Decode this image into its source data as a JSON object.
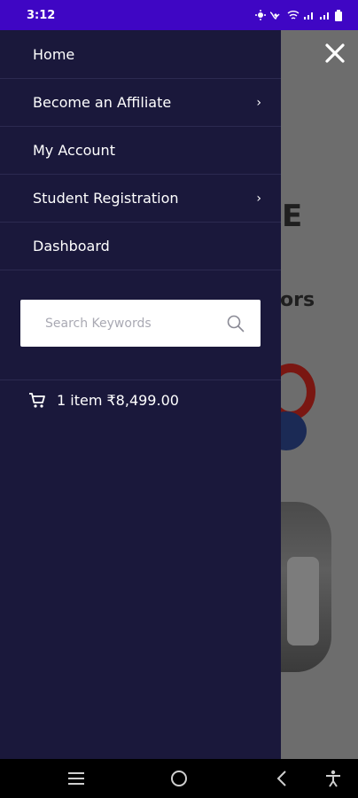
{
  "status_bar": {
    "time": "3:12"
  },
  "drawer": {
    "menu_items": [
      {
        "label": "Home",
        "has_submenu": false
      },
      {
        "label": "Become an Affiliate",
        "has_submenu": true
      },
      {
        "label": "My Account",
        "has_submenu": false
      },
      {
        "label": "Student Registration",
        "has_submenu": true
      },
      {
        "label": "Dashboard",
        "has_submenu": false
      }
    ],
    "submenu_glyph": "›",
    "search": {
      "placeholder": "Search Keywords",
      "value": ""
    },
    "cart": {
      "text": "1 item ₹8,499.00"
    }
  },
  "background_page": {
    "partial_heading_letter": "E",
    "partial_text": "ors"
  },
  "colors": {
    "status_bar": "#3f06c4",
    "drawer_bg": "#1a183b",
    "overlay": "#6d6d6d"
  },
  "icons": [
    "close-icon",
    "search-icon",
    "cart-icon",
    "menu-icon",
    "home-circle-icon",
    "back-icon",
    "accessibility-icon"
  ]
}
